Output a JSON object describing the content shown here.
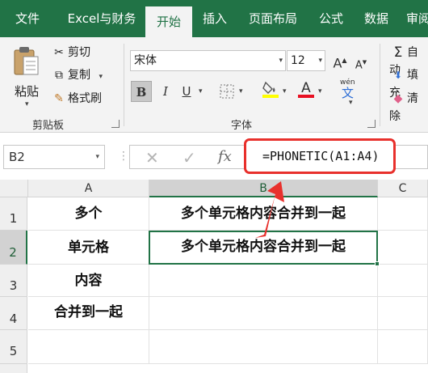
{
  "ribbon_tabs": [
    {
      "label": "文件"
    },
    {
      "label": "Excel与财务"
    },
    {
      "label": "开始"
    },
    {
      "label": "插入"
    },
    {
      "label": "页面布局"
    },
    {
      "label": "公式"
    },
    {
      "label": "数据"
    },
    {
      "label": "审阅"
    }
  ],
  "clipboard": {
    "paste_label": "粘贴",
    "cut_label": "剪切",
    "copy_label": "复制",
    "format_painter_label": "格式刷",
    "group_label": "剪贴板"
  },
  "font": {
    "font_name": "宋体",
    "font_size": "12",
    "bold": "B",
    "italic": "I",
    "underline": "U",
    "font_color_letter": "A",
    "phonetic_top": "wén",
    "phonetic_char": "文",
    "grow_letter": "A",
    "shrink_letter": "A",
    "group_label": "字体"
  },
  "editing": {
    "autosum_label": "自动",
    "fill_label": "填充",
    "clear_label": "清除"
  },
  "formula_bar": {
    "name_box": "B2",
    "fx_label": "fx",
    "formula": "=PHONETIC(A1:A4)"
  },
  "columns": [
    "A",
    "B",
    "C"
  ],
  "rows": [
    {
      "num": "1",
      "a": "多个",
      "b": "多个单元格内容合并到一起"
    },
    {
      "num": "2",
      "a": "单元格",
      "b": "多个单元格内容合并到一起"
    },
    {
      "num": "3",
      "a": "内容",
      "b": ""
    },
    {
      "num": "4",
      "a": "合并到一起",
      "b": ""
    },
    {
      "num": "5",
      "a": "",
      "b": ""
    }
  ],
  "colors": {
    "excel_green": "#217346",
    "highlight_red": "#e8302c",
    "fill_yellow": "#ffff00",
    "font_red": "#e81123"
  }
}
